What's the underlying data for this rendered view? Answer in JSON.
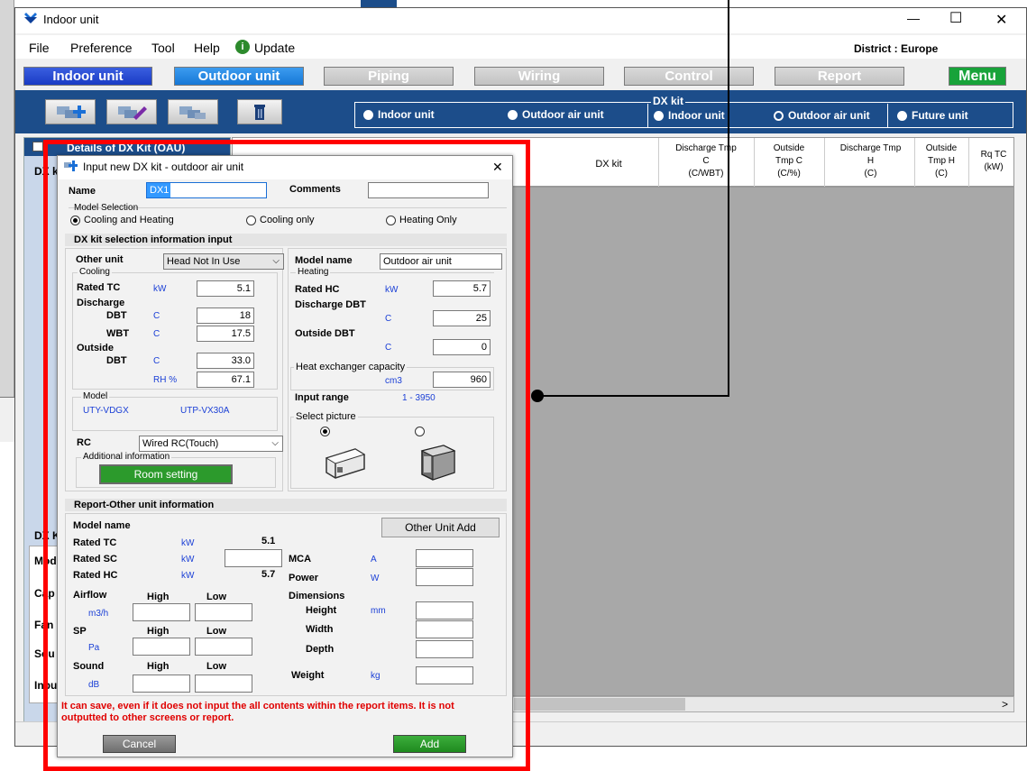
{
  "window": {
    "title": "Indoor unit",
    "district": "District : Europe",
    "min": "—",
    "max": "☐",
    "close": "✕"
  },
  "menu": [
    "File",
    "Preference",
    "Tool",
    "Help",
    "Update"
  ],
  "tabs": [
    {
      "label": "Indoor unit",
      "state": "active"
    },
    {
      "label": "Outdoor unit",
      "state": "selected"
    },
    {
      "label": "Piping",
      "state": "disabled"
    },
    {
      "label": "Wiring",
      "state": "disabled"
    },
    {
      "label": "Control",
      "state": "disabled"
    },
    {
      "label": "Report",
      "state": "disabled"
    },
    {
      "label": "Menu",
      "state": "menu"
    }
  ],
  "unit_radios": {
    "indoor": "Indoor unit",
    "outdoor_air": "Outdoor air unit"
  },
  "dxkit": {
    "label": "DX kit",
    "indoor": "Indoor unit",
    "outdoor": "Outdoor air unit",
    "future": "Future unit"
  },
  "details_title": "Details of DX Kit (OAU)",
  "side_labels": [
    "DX k",
    "DX K",
    "Mod",
    "Cap",
    "Fan",
    "Sou",
    "Inpu"
  ],
  "table_headers": [
    {
      "l1": "DX kit",
      "l2": "",
      "l3": ""
    },
    {
      "l1": "Discharge Tmp",
      "l2": "C",
      "l3": "(C/WBT)"
    },
    {
      "l1": "Outside",
      "l2": "Tmp C",
      "l3": "(C/%)"
    },
    {
      "l1": "Discharge Tmp",
      "l2": "H",
      "l3": "(C)"
    },
    {
      "l1": "Outside",
      "l2": "Tmp H",
      "l3": "(C)"
    },
    {
      "l1": "Rq TC",
      "l2": "(kW)",
      "l3": ""
    }
  ],
  "scroll_right": ">",
  "dialog": {
    "title": "Input new DX kit - outdoor air unit",
    "close": "✕",
    "name_label": "Name",
    "name_value": "DX1",
    "comments_label": "Comments",
    "comments_value": "",
    "model_selection": {
      "label": "Model Selection",
      "options": [
        "Cooling and Heating",
        "Cooling only",
        "Heating Only"
      ],
      "selected": "Cooling and Heating"
    },
    "section1": "DX kit selection information input",
    "other_unit_label": "Other unit",
    "other_unit_value": "Head Not In Use",
    "cooling": {
      "group": "Cooling",
      "rated_tc": "Rated TC",
      "rated_tc_unit": "kW",
      "rated_tc_value": "5.1",
      "discharge": "Discharge",
      "dbt": "DBT",
      "dbt_unit": "C",
      "dbt_value": "18",
      "wbt": "WBT",
      "wbt_unit": "C",
      "wbt_value": "17.5",
      "outside": "Outside",
      "out_dbt": "DBT",
      "out_dbt_unit": "C",
      "out_dbt_value": "33.0",
      "rh_unit": "RH %",
      "rh_value": "67.1"
    },
    "model_group": {
      "label": "Model",
      "indoor": "UTY-VDGX",
      "outdoor": "UTP-VX30A"
    },
    "rc_label": "RC",
    "rc_value": "Wired RC(Touch)",
    "additional_info": "Additional information",
    "room_setting": "Room setting",
    "model_name_label": "Model name",
    "model_name_value": "Outdoor air unit",
    "heating": {
      "group": "Heating",
      "rated_hc": "Rated HC",
      "rated_hc_unit": "kW",
      "rated_hc_value": "5.7",
      "discharge_dbt": "Discharge  DBT",
      "discharge_unit": "C",
      "discharge_value": "25",
      "outside_dbt": "Outside DBT",
      "outside_unit": "C",
      "outside_value": "0"
    },
    "hex": {
      "label": "Heat exchanger capacity",
      "unit": "cm3",
      "value": "960"
    },
    "input_range_label": "Input range",
    "input_range_value": "1 - 3950",
    "select_picture": "Select picture",
    "section2": "Report-Other unit information",
    "report": {
      "model_name": "Model name",
      "other_unit_add": "Other Unit Add",
      "rated_tc": "Rated TC",
      "rated_tc_unit": "kW",
      "rated_tc_value": "5.1",
      "rated_sc": "Rated SC",
      "rated_sc_unit": "kW",
      "rated_hc": "Rated HC",
      "rated_hc_unit": "kW",
      "rated_hc_value": "5.7",
      "airflow": "Airflow",
      "airflow_unit": "m3/h",
      "sp": "SP",
      "sp_unit": "Pa",
      "sound": "Sound",
      "sound_unit": "dB",
      "high": "High",
      "low": "Low",
      "mca": "MCA",
      "mca_unit": "A",
      "power": "Power",
      "power_unit": "W",
      "dimensions": "Dimensions",
      "height": "Height",
      "height_unit": "mm",
      "width": "Width",
      "depth": "Depth",
      "weight": "Weight",
      "weight_unit": "kg"
    },
    "warning": "It can save, even if it does not input the all contents within the report items. It is not outputted to other screens or report.",
    "cancel": "Cancel",
    "add": "Add"
  },
  "colors": {
    "accent_blue": "#1c4d8a",
    "menu_green": "#18a33a",
    "highlight_red": "#ff0000",
    "warning_red": "#e00000"
  }
}
